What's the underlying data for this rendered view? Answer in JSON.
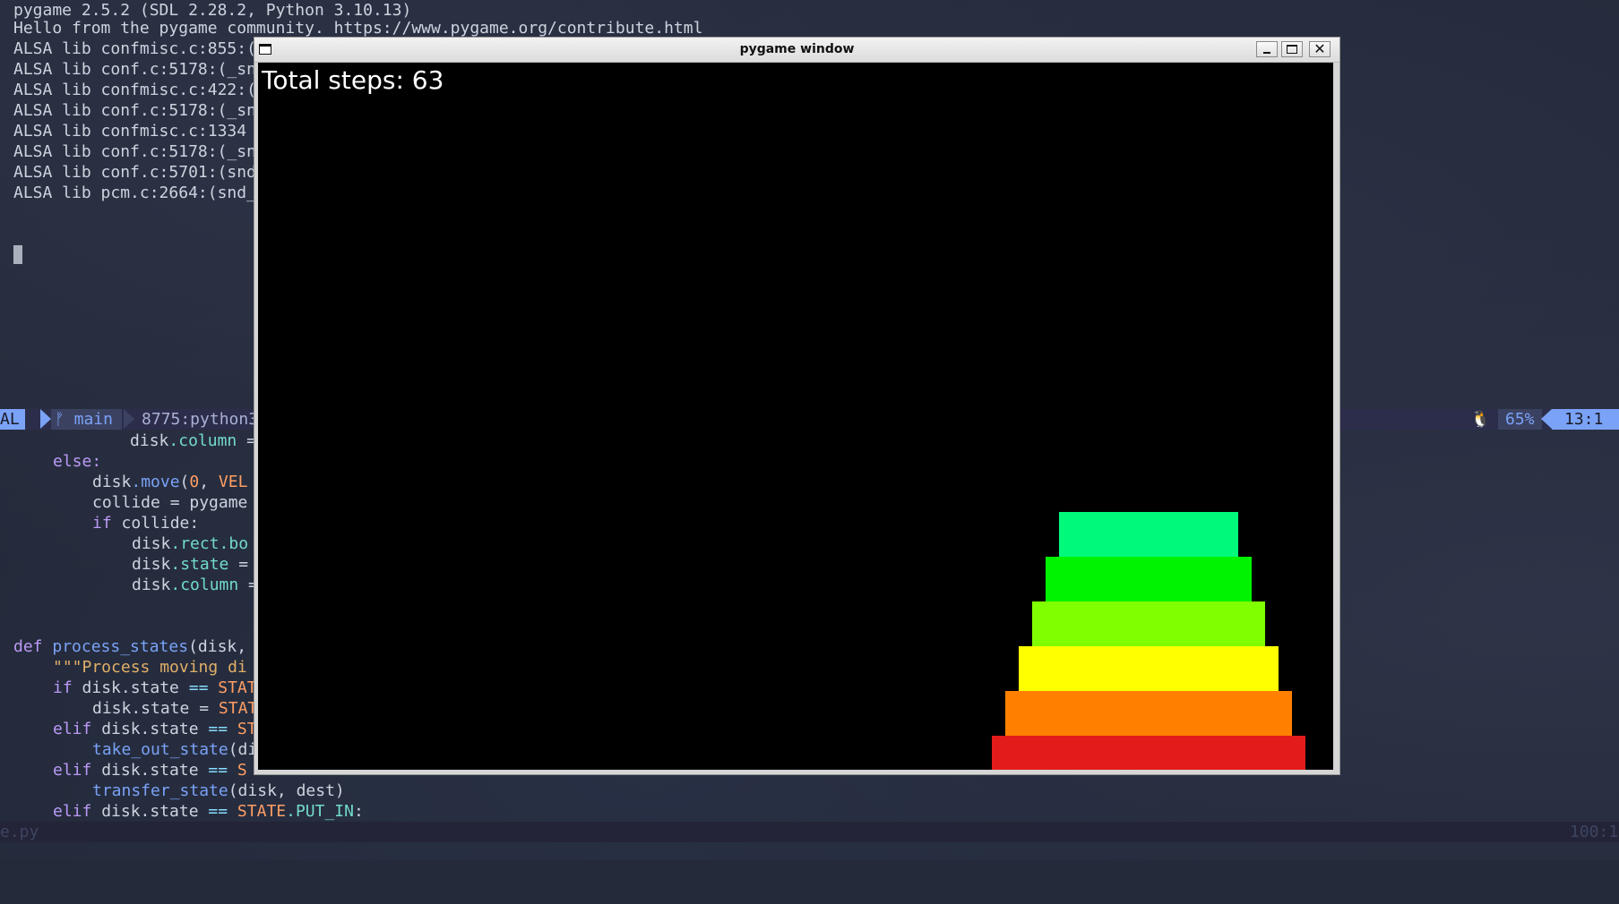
{
  "terminal": {
    "lines": [
      "pygame 2.5.2 (SDL 2.28.2, Python 3.10.13)",
      "Hello from the pygame community. https://www.pygame.org/contribute.html",
      "ALSA lib confmisc.c:855:(",
      "ALSA lib conf.c:5178:(_sn",
      "ALSA lib confmisc.c:422:(",
      "ALSA lib conf.c:5178:(_sn",
      "ALSA lib confmisc.c:1334",
      "ALSA lib conf.c:5178:(_sn",
      "ALSA lib conf.c:5701:(snd",
      "ALSA lib pcm.c:2664:(snd_"
    ]
  },
  "statusline": {
    "mode": "AL",
    "branch": "ᚠ main",
    "file": "8775:python3",
    "linux_icon": "🐧",
    "percent": "65%",
    "position": "13:1"
  },
  "code": {
    "line1_indent": "            ",
    "line1_obj": "disk",
    "line1_attr": ".column",
    "line1_rest": " =",
    "line2_kw": "else:",
    "line3_obj": "disk",
    "line3_fn": ".move",
    "line3_paren": "(",
    "line3_num": "0",
    "line3_sep": ", ",
    "line3_const": "VEL",
    "line4_text": "collide = pygame",
    "line5_kw": "if",
    "line5_text": " collide:",
    "line6_obj": "disk",
    "line6_attr": ".rect.bo",
    "line7_obj": "disk",
    "line7_attr": ".state",
    "line7_rest": " =",
    "line8_obj": "disk",
    "line8_attr": ".column",
    "line8_rest": " =",
    "def_kw": "def",
    "def_fn": " process_states",
    "def_rest": "(disk,",
    "doc": "\"\"\"Process moving di",
    "if_kw": "if",
    "if_rest": " disk.state ",
    "if_op": "==",
    "if_const": " STAT",
    "assign_text": "disk.state = ",
    "assign_const": "STAT",
    "elif1_kw": "elif",
    "elif1_rest": " disk.state ",
    "elif1_op": "==",
    "elif1_const": " ST",
    "take_fn": "take_out_state",
    "take_rest": "(di",
    "elif2_kw": "elif",
    "elif2_rest": " disk.state ",
    "elif2_op": "==",
    "elif2_const": " S",
    "transfer_fn": "transfer_state",
    "transfer_rest": "(disk, dest)",
    "elif3_kw": "elif",
    "elif3_rest": " disk.state ",
    "elif3_op": "==",
    "elif3_const": " STATE",
    "elif3_attr": ".PUT_IN",
    "elif3_end": ":"
  },
  "bottombar": {
    "file": "e.py",
    "position": "100:1"
  },
  "pygame_window": {
    "title": "pygame window",
    "steps_text": "Total steps: 63",
    "disks": [
      {
        "color": "#00f97a"
      },
      {
        "color": "#00f300"
      },
      {
        "color": "#80ff00"
      },
      {
        "color": "#ffff00"
      },
      {
        "color": "#ff8000"
      },
      {
        "color": "#e31b1b"
      }
    ]
  },
  "colors": {
    "background": "#242a3a",
    "accent": "#7aa2f7"
  }
}
